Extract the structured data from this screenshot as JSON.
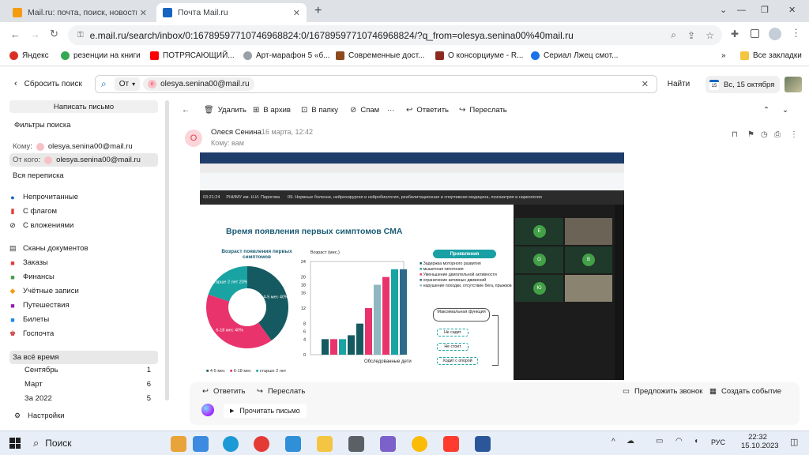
{
  "tabs": [
    {
      "title": "Mail.ru: почта, поиск, новости, ...",
      "active": false
    },
    {
      "title": "Почта Mail.ru",
      "active": true
    }
  ],
  "new_tab_symbol": "+",
  "window_controls": {
    "minimize": "—",
    "maximize": "❐",
    "close": "✕"
  },
  "address_bar": {
    "url": "e.mail.ru/search/inbox/0:16789597710746968824:0/16789597710746968824/?q_from=olesya.senina00%40mail.ru"
  },
  "bookmarks": [
    {
      "label": "Яндекс",
      "color": "#d93025"
    },
    {
      "label": "резенции на книги",
      "color": "#34a853"
    },
    {
      "label": "ПОТРЯСАЮЩИЙ...",
      "color": "#ff0000"
    },
    {
      "label": "Арт-марафон 5 «б...",
      "color": "#9aa0a6"
    },
    {
      "label": "Современные дост...",
      "color": "#8d4a1f"
    },
    {
      "label": "О консорциуме - R...",
      "color": "#8d2a1f"
    },
    {
      "label": "Сериал Лжец смот...",
      "color": "#1a73e8"
    }
  ],
  "bookmarks_more": "»",
  "all_bookmarks": "Все закладки",
  "search": {
    "reset_label": "Сбросить поиск",
    "from_chip": "От",
    "email_chip": "olesya.senina00@mail.ru",
    "find_button": "Найти",
    "date": "Вс, 15 октября",
    "calendar_day": "15"
  },
  "sidebar": {
    "compose": "Написать письмо",
    "filters_title": "Фильтры поиска",
    "to_label": "Кому",
    "to_value": "olesya.senina00@mail.ru",
    "from_label": "От кого",
    "from_value": "olesya.senina00@mail.ru",
    "all_threads": "Вся переписка",
    "flags": [
      "Непрочитанные",
      "С флагом",
      "С вложениями"
    ],
    "folders": [
      "Сканы документов",
      "Заказы",
      "Финансы",
      "Учётные записи",
      "Путешествия",
      "Билеты",
      "Госпочта"
    ],
    "period_title": "За всё время",
    "periods": [
      {
        "label": "Сентябрь",
        "count": "1"
      },
      {
        "label": "Март",
        "count": "6"
      },
      {
        "label": "За 2022",
        "count": "5"
      }
    ],
    "settings": "Настройки"
  },
  "toolbar": {
    "delete": "Удалить",
    "archive": "В архив",
    "folder": "В папку",
    "spam": "Спам",
    "more": "···",
    "reply": "Ответить",
    "forward": "Переслать"
  },
  "message": {
    "sender": "Олеся Сенина",
    "date": "16 марта, 12:42",
    "to_line": "Кому: вам",
    "avatar_letter": "О"
  },
  "slide": {
    "clock": "03:21:24",
    "session": "РНИМУ им. Н.И. Пирогова",
    "course": "09. Нервные болезни, нейрохирургия и нейробиология, реабилитационная и спортивная медицина, психиатрия и наркология",
    "title": "Время появления первых симптомов СМА",
    "pie_title": "Возраст появления первых симптомов",
    "pie_segments": [
      {
        "label": "старше 2 лет",
        "value": 20,
        "text": "старше 2 лет 20%",
        "color": "#1aa3a3"
      },
      {
        "label": "4-5 мес",
        "value": 40,
        "text": "4-5 мес 40%",
        "color": "#155a61"
      },
      {
        "label": "6-18 мес",
        "value": 40,
        "text": "6-18 мес 40%",
        "color": "#e8336d"
      }
    ],
    "pie_legend": [
      "4-5 мес",
      "6-18 мес",
      "старше 2 лет"
    ],
    "bar_ylabel": "Возраст (мес.)",
    "bar_xlabel": "Обследованные дети",
    "bar_yticks": [
      "24",
      "20",
      "18",
      "16",
      "12",
      "8",
      "6",
      "4",
      "0"
    ],
    "bar_values": [
      4,
      4,
      4,
      5,
      8,
      12,
      18,
      20,
      22,
      22
    ],
    "manifest_title": "Проявления",
    "manifest": [
      "Задержка моторного развития",
      "мышечная гипотония",
      "Уменьшение двигательной активности",
      "ограничение активных движений",
      "нарушение походки, отсутствие бега, прыжков"
    ],
    "flow_main": "Максимальная функция",
    "flow_items": [
      "Не сидит",
      "Не стоит",
      "Ходит с опорой"
    ],
    "participants": [
      "Е",
      "О",
      "В",
      "Ю"
    ]
  },
  "chart_data": [
    {
      "type": "pie",
      "title": "Возраст появления первых симптомов",
      "categories": [
        "4-5 мес",
        "6-18 мес",
        "старше 2 лет"
      ],
      "values": [
        40,
        40,
        20
      ]
    },
    {
      "type": "bar",
      "title": "",
      "xlabel": "Обследованные дети",
      "ylabel": "Возраст (мес.)",
      "values": [
        4,
        4,
        4,
        5,
        8,
        12,
        18,
        20,
        22,
        22
      ],
      "ylim": [
        0,
        24
      ]
    }
  ],
  "bottom": {
    "reply": "Ответить",
    "forward": "Переслать",
    "invite_call": "Предложить звонок",
    "create_event": "Создать событие",
    "read_aloud": "Прочитать письмо"
  },
  "taskbar": {
    "search": "Поиск",
    "lang": "РУС",
    "time": "22:32",
    "date": "15.10.2023",
    "weather": "^"
  }
}
